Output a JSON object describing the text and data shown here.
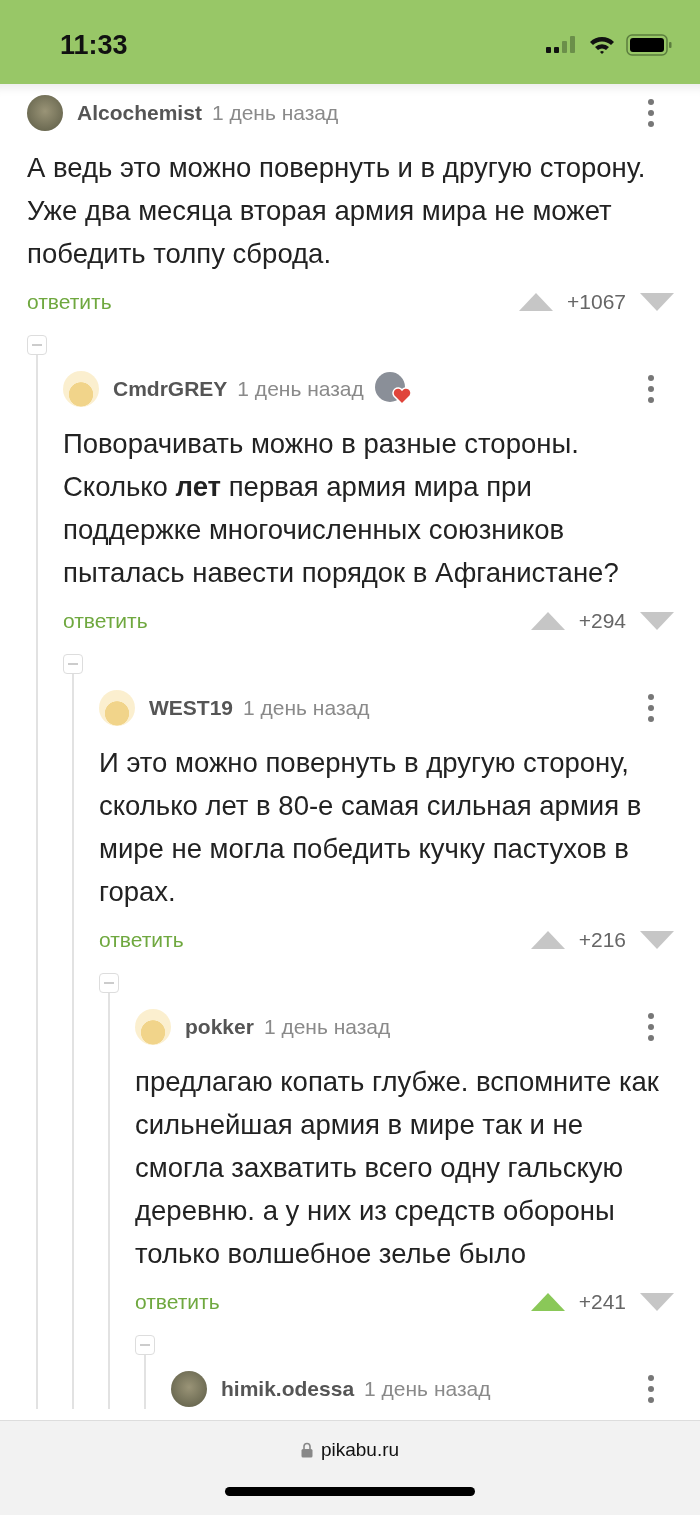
{
  "status_bar": {
    "time": "11:33"
  },
  "comments": [
    {
      "author": "Alcochemist",
      "kind": "photo",
      "time": "1 день назад",
      "award": false,
      "text": "А ведь это можно повернуть и в другую сторону. Уже два месяца вторая армия мира не может победить толпу сброда.",
      "reply": "ответить",
      "score": "+1067",
      "upvoted": false,
      "children": [
        {
          "author": "CmdrGREY",
          "kind": "default",
          "time": "1 день назад",
          "award": true,
          "text": "Поворачивать можно в разные стороны. Сколько **лет** первая армия мира при поддержке многочисленных союзников пыталась навести порядок в Афганистане?",
          "reply": "ответить",
          "score": "+294",
          "upvoted": false,
          "children": [
            {
              "author": "WEST19",
              "kind": "default",
              "time": "1 день назад",
              "award": false,
              "text": "И это можно повернуть в другую сторону, сколько лет в 80-е самая сильная армия в мире не могла победить кучку пастухов в горах.",
              "reply": "ответить",
              "score": "+216",
              "upvoted": false,
              "children": [
                {
                  "author": "pokker",
                  "kind": "default",
                  "time": "1 день назад",
                  "award": false,
                  "text": "предлагаю копать глубже. вспомните как сильнейшая армия в мире так и не смогла захватить всего одну гальскую деревню. а у них из средств обороны только волшебное зелье было",
                  "reply": "ответить",
                  "score": "+241",
                  "upvoted": true,
                  "children": [
                    {
                      "author": "himik.odessa",
                      "kind": "photo",
                      "time": "1 день назад",
                      "award": false
                    }
                  ]
                }
              ]
            }
          ]
        }
      ]
    }
  ],
  "address_bar": {
    "url": "pikabu.ru"
  }
}
